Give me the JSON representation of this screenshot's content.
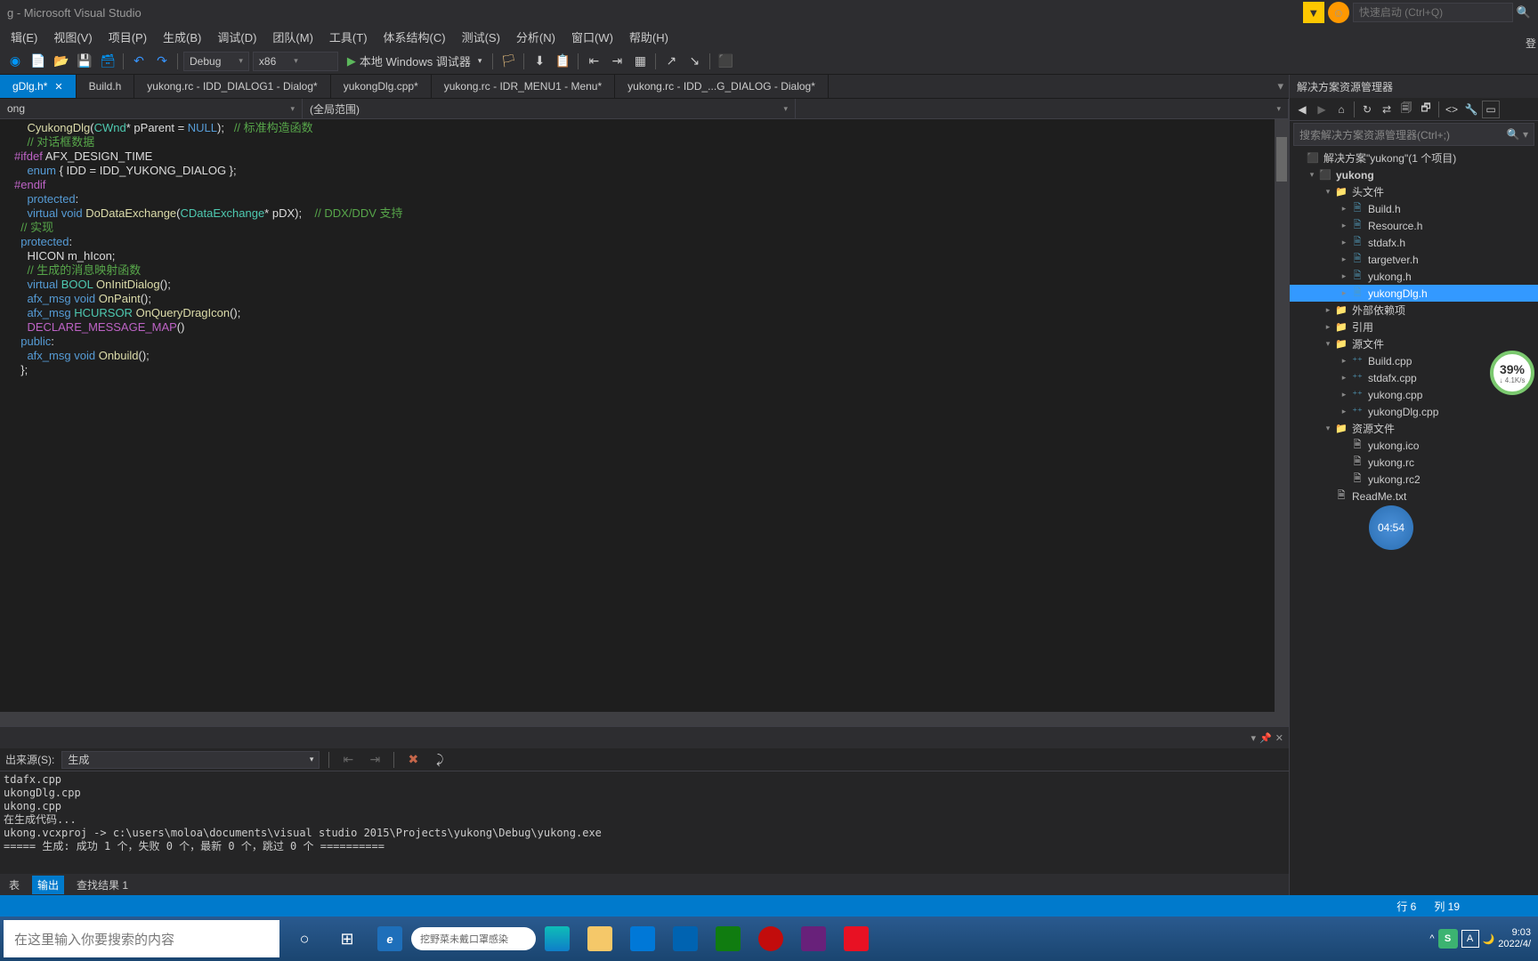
{
  "title": "g - Microsoft Visual Studio",
  "quicklaunch_placeholder": "快速启动 (Ctrl+Q)",
  "login": "登",
  "menu": [
    "辑(E)",
    "视图(V)",
    "项目(P)",
    "生成(B)",
    "调试(D)",
    "团队(M)",
    "工具(T)",
    "体系结构(C)",
    "测试(S)",
    "分析(N)",
    "窗口(W)",
    "帮助(H)"
  ],
  "toolbar": {
    "config": "Debug",
    "platform": "x86",
    "run": "本地 Windows 调试器"
  },
  "tabs": [
    {
      "label": "gDlg.h*",
      "active": true,
      "close": true
    },
    {
      "label": "Build.h"
    },
    {
      "label": "yukong.rc - IDD_DIALOG1 - Dialog*"
    },
    {
      "label": "yukongDlg.cpp*"
    },
    {
      "label": "yukong.rc - IDR_MENU1 - Menu*"
    },
    {
      "label": "yukong.rc - IDD_...G_DIALOG - Dialog*"
    }
  ],
  "nav": {
    "left": "ong",
    "mid": "(全局范围)",
    "right": ""
  },
  "code": [
    {
      "segs": [
        [
          "    ",
          "plain"
        ],
        [
          "CyukongDlg",
          "func"
        ],
        [
          "(",
          "plain"
        ],
        [
          "CWnd",
          "type"
        ],
        [
          "* pParent = ",
          "plain"
        ],
        [
          "NULL",
          "kw"
        ],
        [
          ");   ",
          "plain"
        ],
        [
          "// 标准构造函数",
          "comment"
        ]
      ]
    },
    {
      "segs": [
        [
          "",
          "plain"
        ]
      ]
    },
    {
      "segs": [
        [
          "    ",
          "plain"
        ],
        [
          "// 对话框数据",
          "comment"
        ]
      ]
    },
    {
      "segs": [
        [
          "#ifdef",
          "macro"
        ],
        [
          " AFX_DESIGN_TIME",
          "plain"
        ]
      ]
    },
    {
      "segs": [
        [
          "    ",
          "plain"
        ],
        [
          "enum",
          "kw"
        ],
        [
          " { IDD = IDD_YUKONG_DIALOG };",
          "plain"
        ]
      ]
    },
    {
      "segs": [
        [
          "#endif",
          "macro"
        ]
      ]
    },
    {
      "segs": [
        [
          "",
          "plain"
        ]
      ]
    },
    {
      "segs": [
        [
          "    ",
          "plain"
        ],
        [
          "protected",
          "kw"
        ],
        [
          ":",
          "plain"
        ]
      ]
    },
    {
      "segs": [
        [
          "    ",
          "plain"
        ],
        [
          "virtual",
          "kw"
        ],
        [
          " ",
          "plain"
        ],
        [
          "void",
          "kw"
        ],
        [
          " ",
          "plain"
        ],
        [
          "DoDataExchange",
          "func"
        ],
        [
          "(",
          "plain"
        ],
        [
          "CDataExchange",
          "type"
        ],
        [
          "* pDX);    ",
          "plain"
        ],
        [
          "// DDX/DDV 支持",
          "comment"
        ]
      ]
    },
    {
      "segs": [
        [
          "",
          "plain"
        ]
      ]
    },
    {
      "segs": [
        [
          "",
          "plain"
        ]
      ]
    },
    {
      "segs": [
        [
          "  ",
          "plain"
        ],
        [
          "// 实现",
          "comment"
        ]
      ]
    },
    {
      "segs": [
        [
          "  ",
          "plain"
        ],
        [
          "protected",
          "kw"
        ],
        [
          ":",
          "plain"
        ]
      ]
    },
    {
      "segs": [
        [
          "    HICON m_hIcon;",
          "plain"
        ]
      ]
    },
    {
      "segs": [
        [
          "",
          "plain"
        ]
      ]
    },
    {
      "segs": [
        [
          "    ",
          "plain"
        ],
        [
          "// 生成的消息映射函数",
          "comment"
        ]
      ]
    },
    {
      "segs": [
        [
          "    ",
          "plain"
        ],
        [
          "virtual",
          "kw"
        ],
        [
          " ",
          "plain"
        ],
        [
          "BOOL",
          "type"
        ],
        [
          " ",
          "plain"
        ],
        [
          "OnInitDialog",
          "func"
        ],
        [
          "();",
          "plain"
        ]
      ]
    },
    {
      "segs": [
        [
          "    ",
          "plain"
        ],
        [
          "afx_msg",
          "kw"
        ],
        [
          " ",
          "plain"
        ],
        [
          "void",
          "kw"
        ],
        [
          " ",
          "plain"
        ],
        [
          "OnPaint",
          "func"
        ],
        [
          "();",
          "plain"
        ]
      ]
    },
    {
      "segs": [
        [
          "    ",
          "plain"
        ],
        [
          "afx_msg",
          "kw"
        ],
        [
          " ",
          "plain"
        ],
        [
          "HCURSOR",
          "type"
        ],
        [
          " ",
          "plain"
        ],
        [
          "OnQueryDragIcon",
          "func"
        ],
        [
          "();",
          "plain"
        ]
      ]
    },
    {
      "segs": [
        [
          "    ",
          "plain"
        ],
        [
          "DECLARE_MESSAGE_MAP",
          "macro"
        ],
        [
          "()",
          "plain"
        ]
      ]
    },
    {
      "segs": [
        [
          "  ",
          "plain"
        ],
        [
          "public",
          "kw"
        ],
        [
          ":",
          "plain"
        ]
      ]
    },
    {
      "segs": [
        [
          "    ",
          "plain"
        ],
        [
          "afx_msg",
          "kw"
        ],
        [
          " ",
          "plain"
        ],
        [
          "void",
          "kw"
        ],
        [
          " ",
          "plain"
        ],
        [
          "Onbuild",
          "func"
        ],
        [
          "();",
          "plain"
        ]
      ]
    },
    {
      "segs": [
        [
          "  };",
          "plain"
        ]
      ]
    }
  ],
  "output": {
    "source_label": "出来源(S):",
    "source_value": "生成",
    "lines": [
      "tdafx.cpp",
      "ukongDlg.cpp",
      "ukong.cpp",
      "在生成代码...",
      "ukong.vcxproj -> c:\\users\\moloa\\documents\\visual studio 2015\\Projects\\yukong\\Debug\\yukong.exe",
      "===== 生成: 成功 1 个，失败 0 个，最新 0 个，跳过 0 个 =========="
    ],
    "tabs": [
      "表",
      "输出",
      "查找结果 1"
    ],
    "active_tab": 1
  },
  "solution": {
    "title": "解决方案资源管理器",
    "search_placeholder": "搜索解决方案资源管理器(Ctrl+;)",
    "tree": [
      {
        "d": 0,
        "arrow": "",
        "icon": "sln",
        "label": "解决方案\"yukong\"(1 个项目)"
      },
      {
        "d": 1,
        "arrow": "▾",
        "icon": "proj",
        "label": "yukong",
        "bold": true
      },
      {
        "d": 2,
        "arrow": "▾",
        "icon": "folder",
        "label": "头文件"
      },
      {
        "d": 3,
        "arrow": "▸",
        "icon": "h",
        "label": "Build.h"
      },
      {
        "d": 3,
        "arrow": "▸",
        "icon": "h",
        "label": "Resource.h"
      },
      {
        "d": 3,
        "arrow": "▸",
        "icon": "h",
        "label": "stdafx.h"
      },
      {
        "d": 3,
        "arrow": "▸",
        "icon": "h",
        "label": "targetver.h"
      },
      {
        "d": 3,
        "arrow": "▸",
        "icon": "h",
        "label": "yukong.h"
      },
      {
        "d": 3,
        "arrow": "▸",
        "icon": "h",
        "label": "yukongDlg.h",
        "selected": true
      },
      {
        "d": 2,
        "arrow": "▸",
        "icon": "folder",
        "label": "外部依赖项"
      },
      {
        "d": 2,
        "arrow": "▸",
        "icon": "folder",
        "label": "引用"
      },
      {
        "d": 2,
        "arrow": "▾",
        "icon": "folder",
        "label": "源文件"
      },
      {
        "d": 3,
        "arrow": "▸",
        "icon": "cpp",
        "label": "Build.cpp"
      },
      {
        "d": 3,
        "arrow": "▸",
        "icon": "cpp",
        "label": "stdafx.cpp"
      },
      {
        "d": 3,
        "arrow": "▸",
        "icon": "cpp",
        "label": "yukong.cpp"
      },
      {
        "d": 3,
        "arrow": "▸",
        "icon": "cpp",
        "label": "yukongDlg.cpp"
      },
      {
        "d": 2,
        "arrow": "▾",
        "icon": "folder",
        "label": "资源文件"
      },
      {
        "d": 3,
        "arrow": "",
        "icon": "file",
        "label": "yukong.ico"
      },
      {
        "d": 3,
        "arrow": "",
        "icon": "file",
        "label": "yukong.rc"
      },
      {
        "d": 3,
        "arrow": "",
        "icon": "file",
        "label": "yukong.rc2"
      },
      {
        "d": 2,
        "arrow": "",
        "icon": "file",
        "label": "ReadMe.txt"
      }
    ]
  },
  "status": {
    "line": "行 6",
    "col": "列 19"
  },
  "floating": {
    "pct": "39%",
    "pct_sub": "↓ 4.1K/s",
    "timer": "04:54"
  },
  "taskbar": {
    "search_placeholder": "在这里输入你要搜索的内容",
    "edge_search": "挖野菜未戴口罩感染",
    "time": "9:03",
    "date": "2022/4/"
  }
}
